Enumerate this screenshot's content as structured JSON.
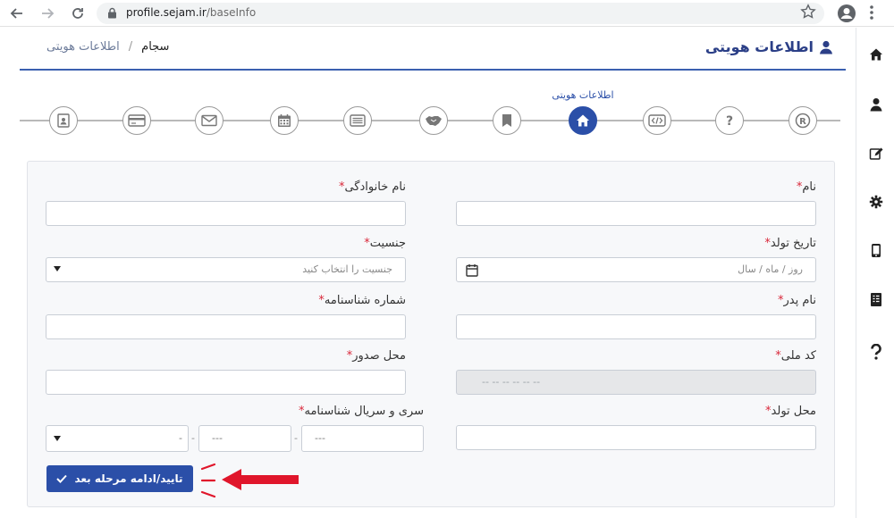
{
  "browser": {
    "url_host": "profile.sejam.ir",
    "url_path": "/baseInfo"
  },
  "header": {
    "title": "اطلاعات هویتی",
    "breadcrumb": {
      "home": "سجام",
      "separator": "/",
      "current": "اطلاعات هویتی"
    }
  },
  "stepper": {
    "active_label": "اطلاعات هویتی",
    "steps": [
      "registered-icon",
      "question-icon",
      "code-icon",
      "home-icon",
      "bookmark-icon",
      "handshake-icon",
      "list-icon",
      "calendar-icon",
      "envelope-icon",
      "card-icon",
      "contact-icon"
    ]
  },
  "form": {
    "first_name": {
      "label": "نام",
      "value": ""
    },
    "last_name": {
      "label": "نام خانوادگی",
      "value": ""
    },
    "birth_date": {
      "label": "تاریخ تولد",
      "placeholder": "روز / ماه / سال"
    },
    "gender": {
      "label": "جنسیت",
      "placeholder": "جنسیت را انتخاب کنید"
    },
    "father_name": {
      "label": "نام پدر",
      "value": ""
    },
    "id_number": {
      "label": "شماره شناسنامه",
      "value": ""
    },
    "national_code": {
      "label": "کد ملی",
      "value": "-- -- -- -- -- --"
    },
    "issue_place": {
      "label": "محل صدور",
      "value": ""
    },
    "birth_place": {
      "label": "محل تولد",
      "value": ""
    },
    "serial": {
      "label": "سری و سریال شناسنامه",
      "part1": "---",
      "part2": "---",
      "part3": "-",
      "separator": "-"
    },
    "required_mark": "*"
  },
  "submit": {
    "label": "تایید/ادامه مرحله بعد"
  },
  "sidebar": {
    "items": [
      "home-icon",
      "user-icon",
      "edit-icon",
      "gear-icon",
      "mobile-icon",
      "document-icon",
      "help-icon"
    ]
  },
  "colors": {
    "primary": "#2b4fa8",
    "title": "#2b3f87",
    "required": "#d9283a",
    "annotation": "#e0162b"
  }
}
